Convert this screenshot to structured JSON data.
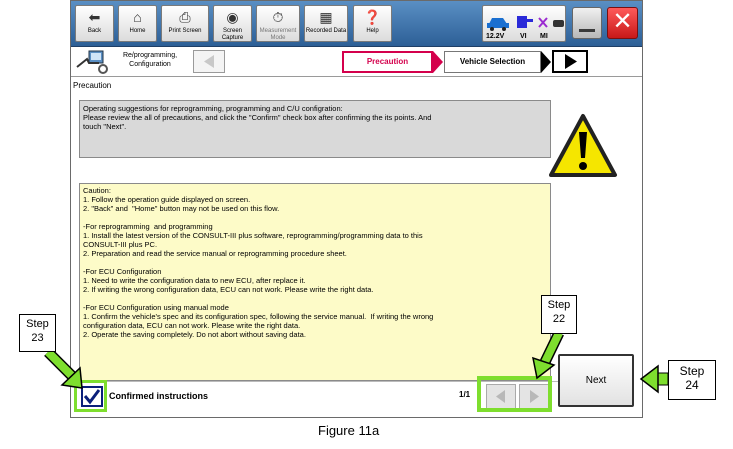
{
  "toolbar": {
    "buttons": [
      {
        "label": "Back",
        "icon": "left-arrow-icon"
      },
      {
        "label": "Home",
        "icon": "home-icon"
      },
      {
        "label": "Print Screen",
        "icon": "printer-icon"
      },
      {
        "label": "Screen Capture",
        "icon": "camera-icon"
      },
      {
        "label": "Measurement Mode",
        "icon": "meter-icon"
      },
      {
        "label": "Recorded Data",
        "icon": "car-data-icon"
      },
      {
        "label": "Help",
        "icon": "question-icon"
      }
    ],
    "status": {
      "voltage": "12.2V",
      "vi_label": "VI",
      "mi_label": "MI"
    },
    "colors": {
      "toolbar_top": "#5a8fc4",
      "toolbar_bottom": "#2d5f96",
      "close_red": "#d42020"
    }
  },
  "breadcrumb": {
    "label_line1": "Re/programming,",
    "label_line2": "Configuration",
    "steps": [
      "Precaution",
      "Vehicle Selection"
    ],
    "active_color": "#d4004c"
  },
  "section_title": "Precaution",
  "top_box": {
    "lines": [
      "Operating suggestions for reprogramming, programming and C/U configration:",
      "Please review the all of precautions, and click the \"Confirm\" check box after confirming the its points. And",
      "touch \"Next\"."
    ]
  },
  "caution": {
    "lines": [
      "Caution:",
      "1. Follow the operation guide displayed on screen.",
      "2. \"Back\" and  \"Home\" button may not be used on this flow.",
      "",
      "-For reprogramming  and programming",
      "1. Install the latest version of the CONSULT-III plus software, reprogramming/programming data to this",
      "CONSULT-III plus PC.",
      "2. Preparation and read the service manual or reprogramming procedure sheet.",
      "",
      "-For ECU Configuration",
      "1. Need to write the configuration data to new ECU, after replace it.",
      "2. If writing the wrong configuration data, ECU can not work. Please write the right data.",
      "",
      "-For ECU Configuration using manual mode",
      "1. Confirm the vehicle's spec and its configuration spec, following the service manual.  If writing the wrong",
      "configuration data, ECU can not work. Please write the right data.",
      "2. Operate the saving completely. Do not abort without saving data."
    ]
  },
  "confirm": {
    "label": "Confirmed instructions",
    "checked": true
  },
  "pagination": {
    "page": "1/1"
  },
  "next_button": {
    "label": "Next"
  },
  "annotations": {
    "step23": {
      "line1": "Step",
      "line2": "23"
    },
    "step22": {
      "line1": "Step",
      "line2": "22"
    },
    "step24": {
      "line1": "Step",
      "line2": "24"
    },
    "highlight_color": "#7ede2e"
  },
  "caption": "Figure 11a"
}
